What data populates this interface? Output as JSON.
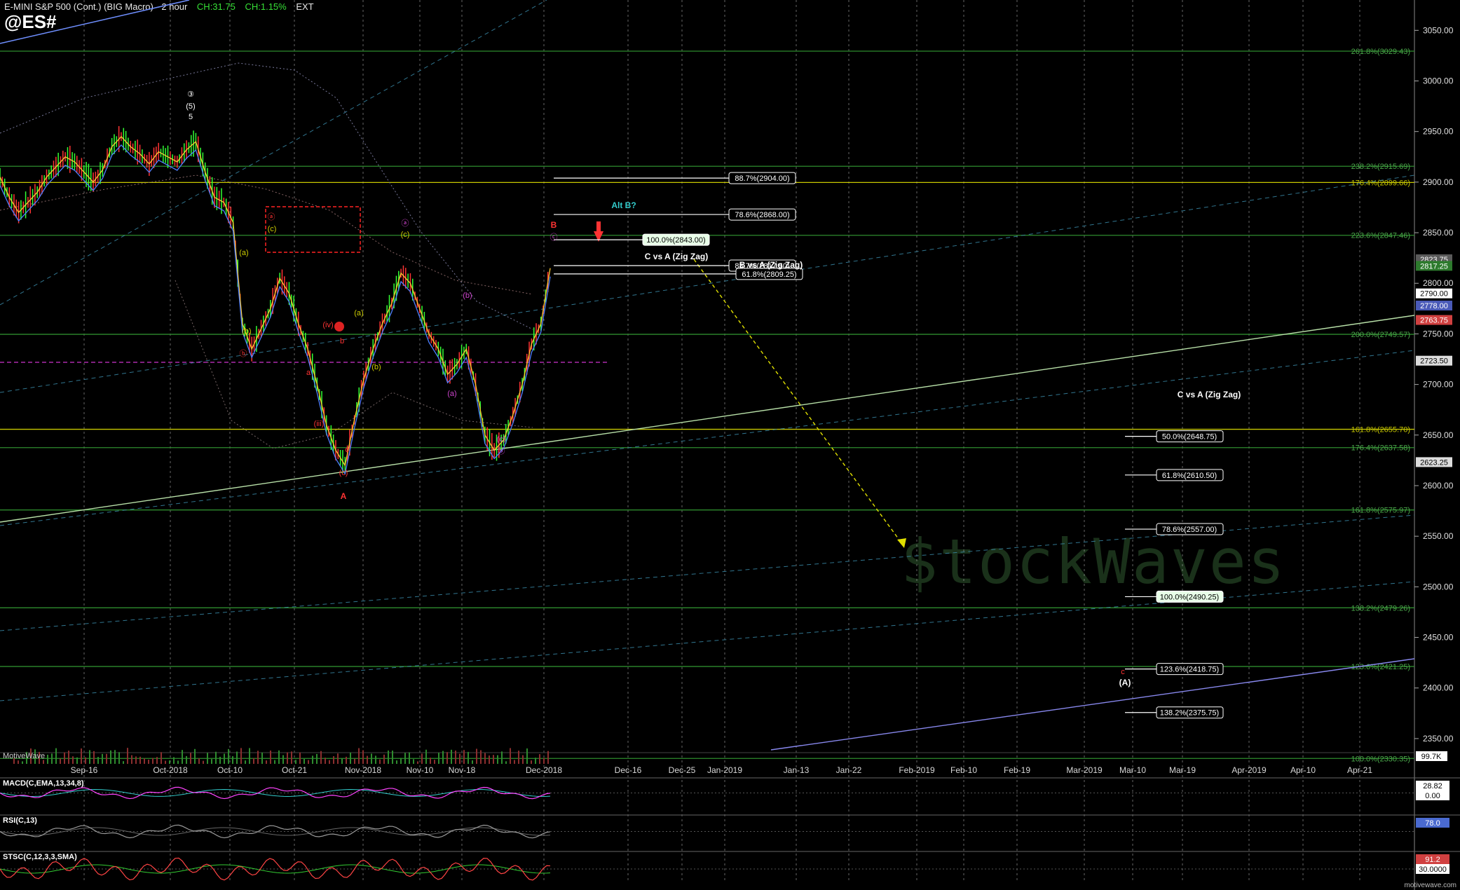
{
  "header": {
    "title": "E-MINI S&P 500 (Cont.) (BIG Macro) - 2 hour",
    "change": "CH:31.75",
    "change_pct": "CH:1.15%",
    "session": "EXT",
    "symbol": "@ES#"
  },
  "watermark": "$tockWaves",
  "footer_brand": "motivewave.com",
  "platform_label": "MotiveWave",
  "colors": {
    "background": "#000000",
    "fib_green": "#2e8b2e",
    "fib_yellow": "#c8c800",
    "price_up": "#33ff33",
    "price_down": "#ff3333",
    "channel_blue": "#3a8aa8",
    "trend_green": "#a8d8a0",
    "trend_purple": "#8888ee"
  },
  "chart_data": [
    {
      "type": "line",
      "name": "price",
      "x_ticks": [
        "Sep-16",
        "Oct-2018",
        "Oct-10",
        "Oct-21",
        "Nov-2018",
        "Nov-10",
        "Nov-18",
        "Dec-2018",
        "Dec-16",
        "Dec-25",
        "Jan-2019",
        "Jan-13",
        "Jan-22",
        "Feb-2019",
        "Feb-10",
        "Feb-19",
        "Mar-2019",
        "Mar-10",
        "Mar-19",
        "Apr-2019",
        "Apr-10",
        "Apr-21"
      ],
      "y_ticks": [
        3050,
        3000,
        2950,
        2900,
        2850,
        2800,
        2750,
        2700,
        2650,
        2600,
        2550,
        2500,
        2450,
        2400,
        2350
      ],
      "ylim": [
        2330,
        3070
      ],
      "price_series": [
        {
          "i": 0,
          "p": 2905
        },
        {
          "i": 10,
          "p": 2885
        },
        {
          "i": 20,
          "p": 2870
        },
        {
          "i": 30,
          "p": 2880
        },
        {
          "i": 40,
          "p": 2890
        },
        {
          "i": 50,
          "p": 2905
        },
        {
          "i": 60,
          "p": 2915
        },
        {
          "i": 70,
          "p": 2925
        },
        {
          "i": 80,
          "p": 2920
        },
        {
          "i": 90,
          "p": 2910
        },
        {
          "i": 100,
          "p": 2900
        },
        {
          "i": 110,
          "p": 2912
        },
        {
          "i": 120,
          "p": 2935
        },
        {
          "i": 130,
          "p": 2945
        },
        {
          "i": 140,
          "p": 2935
        },
        {
          "i": 150,
          "p": 2928
        },
        {
          "i": 160,
          "p": 2918
        },
        {
          "i": 170,
          "p": 2930
        },
        {
          "i": 180,
          "p": 2925
        },
        {
          "i": 190,
          "p": 2920
        },
        {
          "i": 200,
          "p": 2932
        },
        {
          "i": 210,
          "p": 2940
        },
        {
          "i": 220,
          "p": 2910
        },
        {
          "i": 230,
          "p": 2885
        },
        {
          "i": 240,
          "p": 2880
        },
        {
          "i": 250,
          "p": 2860
        },
        {
          "i": 260,
          "p": 2760
        },
        {
          "i": 270,
          "p": 2735
        },
        {
          "i": 280,
          "p": 2755
        },
        {
          "i": 290,
          "p": 2775
        },
        {
          "i": 300,
          "p": 2805
        },
        {
          "i": 310,
          "p": 2790
        },
        {
          "i": 320,
          "p": 2760
        },
        {
          "i": 330,
          "p": 2735
        },
        {
          "i": 340,
          "p": 2700
        },
        {
          "i": 350,
          "p": 2660
        },
        {
          "i": 360,
          "p": 2635
        },
        {
          "i": 370,
          "p": 2620
        },
        {
          "i": 380,
          "p": 2665
        },
        {
          "i": 390,
          "p": 2705
        },
        {
          "i": 400,
          "p": 2735
        },
        {
          "i": 410,
          "p": 2760
        },
        {
          "i": 420,
          "p": 2780
        },
        {
          "i": 430,
          "p": 2810
        },
        {
          "i": 440,
          "p": 2800
        },
        {
          "i": 450,
          "p": 2775
        },
        {
          "i": 460,
          "p": 2750
        },
        {
          "i": 470,
          "p": 2735
        },
        {
          "i": 480,
          "p": 2710
        },
        {
          "i": 490,
          "p": 2720
        },
        {
          "i": 500,
          "p": 2735
        },
        {
          "i": 510,
          "p": 2700
        },
        {
          "i": 520,
          "p": 2650
        },
        {
          "i": 530,
          "p": 2635
        },
        {
          "i": 540,
          "p": 2645
        },
        {
          "i": 550,
          "p": 2670
        },
        {
          "i": 560,
          "p": 2700
        },
        {
          "i": 570,
          "p": 2740
        },
        {
          "i": 580,
          "p": 2760
        },
        {
          "i": 590,
          "p": 2815
        }
      ],
      "axis_price_labels": [
        {
          "text": "2823.75",
          "bg": "#5a5a5a",
          "fg": "#ffffff",
          "value": 2823.75
        },
        {
          "text": "2817.25",
          "bg": "#2d7a2d",
          "fg": "#ffffff",
          "value": 2817.25
        },
        {
          "text": "2790.00",
          "bg": "#ffffff",
          "fg": "#000000",
          "value": 2790.0
        },
        {
          "text": "2778.00",
          "bg": "#4a5ab8",
          "fg": "#ffffff",
          "value": 2778.0
        },
        {
          "text": "2763.75",
          "bg": "#d04040",
          "fg": "#ffffff",
          "value": 2763.75
        },
        {
          "text": "2723.50",
          "bg": "#dddddd",
          "fg": "#000000",
          "value": 2723.5
        },
        {
          "text": "2623.25",
          "bg": "#dddddd",
          "fg": "#000000",
          "value": 2623.25
        }
      ],
      "volume_label": "99.7K",
      "fib_lines": [
        {
          "label": "261.8%(3029.43)",
          "value": 3029.43,
          "color": "green"
        },
        {
          "label": "238.2%(2915.69)",
          "value": 2915.69,
          "color": "green"
        },
        {
          "label": "176.4%(2899.66)",
          "value": 2899.66,
          "color": "yellow"
        },
        {
          "label": "223.6%(2847.46)",
          "value": 2847.46,
          "color": "green"
        },
        {
          "label": "200.0%(2749.57)",
          "value": 2749.57,
          "color": "green"
        },
        {
          "label": "161.8%(2655.70)",
          "value": 2655.7,
          "color": "yellow"
        },
        {
          "label": "176.4%(2637.58)",
          "value": 2637.58,
          "color": "green"
        },
        {
          "label": "161.8%(2575.97)",
          "value": 2575.97,
          "color": "green"
        },
        {
          "label": "138.2%(2479.26)",
          "value": 2479.26,
          "color": "green"
        },
        {
          "label": "123.6%(2421.25)",
          "value": 2421.25,
          "color": "green"
        },
        {
          "label": "100.0%(2330.35)",
          "value": 2330.35,
          "color": "green"
        }
      ],
      "target_boxes_b": [
        {
          "label": "88.7%(2904.00)",
          "value": 2904.0,
          "bg": "#000",
          "fg": "#fff"
        },
        {
          "label": "78.6%(2868.00)",
          "value": 2868.0,
          "bg": "#000",
          "fg": "#fff"
        },
        {
          "label": "100.0%(2843.00)",
          "value": 2843.0,
          "bg": "#e8ffe8",
          "fg": "#000"
        },
        {
          "label": "88.7%(2817.50)",
          "value": 2817.5,
          "bg": "#000",
          "fg": "#fff"
        },
        {
          "label": "61.8%(2809.25)",
          "value": 2809.25,
          "bg": "#000",
          "fg": "#fff"
        }
      ],
      "target_boxes_c": [
        {
          "label": "50.0%(2648.75)",
          "value": 2648.75,
          "bg": "#000",
          "fg": "#fff"
        },
        {
          "label": "61.8%(2610.50)",
          "value": 2610.5,
          "bg": "#000",
          "fg": "#fff"
        },
        {
          "label": "78.6%(2557.00)",
          "value": 2557.0,
          "bg": "#000",
          "fg": "#fff"
        },
        {
          "label": "100.0%(2490.25)",
          "value": 2490.25,
          "bg": "#e8ffe8",
          "fg": "#000"
        },
        {
          "label": "123.6%(2418.75)",
          "value": 2418.75,
          "bg": "#000",
          "fg": "#fff"
        },
        {
          "label": "138.2%(2375.75)",
          "value": 2375.75,
          "bg": "#000",
          "fg": "#fff"
        }
      ],
      "annotations": [
        {
          "text": "Alt B?",
          "color": "#33cccc"
        },
        {
          "text": "C vs A (Zig Zag)",
          "color": "#ffffff"
        },
        {
          "text": "B vs A (Zig Zag)",
          "color": "#ffffff"
        },
        {
          "text": "C vs A (Zig Zag)",
          "color": "#ffffff"
        },
        {
          "text": "③",
          "color": "#ffffff"
        },
        {
          "text": "(5)",
          "color": "#ffffff"
        },
        {
          "text": "5",
          "color": "#ffffff"
        },
        {
          "text": "B",
          "color": "#ff3333"
        },
        {
          "text": "ⓒ",
          "color": "#cc44cc"
        },
        {
          "text": "A",
          "color": "#ff3333"
        },
        {
          "text": "c",
          "color": "#ff3333"
        },
        {
          "text": "(A)",
          "color": "#ffffff"
        },
        {
          "text": "ⓐ",
          "color": "#ff3333"
        },
        {
          "text": "ⓑ",
          "color": "#ff3333"
        },
        {
          "text": "(c)",
          "color": "#cccc00"
        },
        {
          "text": "(a)",
          "color": "#cccc00"
        },
        {
          "text": "(b)",
          "color": "#cccc00"
        },
        {
          "text": "ⓐ",
          "color": "#cc44cc"
        },
        {
          "text": "(c)",
          "color": "#cccc00"
        },
        {
          "text": "(a)",
          "color": "#cccc00"
        },
        {
          "text": "(b)",
          "color": "#cccc00"
        },
        {
          "text": "(b)",
          "color": "#cc44cc"
        },
        {
          "text": "(a)",
          "color": "#cc44cc"
        },
        {
          "text": "(c)",
          "color": "#cc44cc"
        },
        {
          "text": "ⓑ",
          "color": "#cc44cc"
        },
        {
          "text": "(iii)",
          "color": "#ff3333"
        },
        {
          "text": "(iv)",
          "color": "#ff3333"
        },
        {
          "text": "a",
          "color": "#ff3333"
        },
        {
          "text": "b",
          "color": "#ff3333"
        },
        {
          "text": "c",
          "color": "#ff3333"
        },
        {
          "text": "(c)",
          "color": "#ff3333"
        }
      ]
    },
    {
      "type": "line",
      "name": "MACD(C,EMA,13,34,8)",
      "value_labels": [
        "28.82",
        "0.00"
      ]
    },
    {
      "type": "line",
      "name": "RSI(C,13)",
      "value_labels": [
        "78.0"
      ]
    },
    {
      "type": "line",
      "name": "STSC(C,12,3,3,SMA)",
      "value_labels": [
        "91.2",
        "30.0000"
      ]
    }
  ]
}
